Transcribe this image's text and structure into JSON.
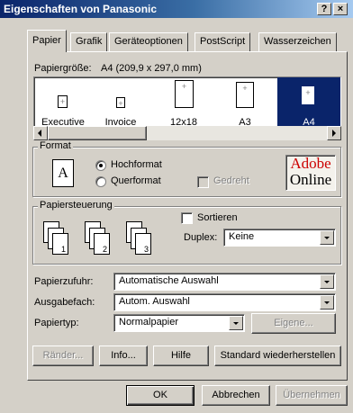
{
  "window": {
    "title": "Eigenschaften von Panasonic",
    "help_button": "?",
    "close_button": "×"
  },
  "tabs": [
    {
      "label": "Papier",
      "active": true
    },
    {
      "label": "Grafik",
      "active": false
    },
    {
      "label": "Geräteoptionen",
      "active": false
    },
    {
      "label": "PostScript",
      "active": false
    },
    {
      "label": "Wasserzeichen",
      "active": false
    }
  ],
  "paper_size": {
    "label": "Papiergröße:",
    "value": "A4 (209,9 x 297,0 mm)",
    "items": [
      {
        "name": "Executive",
        "selected": false
      },
      {
        "name": "Invoice",
        "selected": false
      },
      {
        "name": "12x18",
        "selected": false
      },
      {
        "name": "A3",
        "selected": false
      },
      {
        "name": "A4",
        "selected": true
      }
    ],
    "selection_color": "#0a246a"
  },
  "format": {
    "label": "Format",
    "options": [
      {
        "label": "Hochformat",
        "checked": true
      },
      {
        "label": "Querformat",
        "checked": false
      }
    ],
    "rotated_label": "Gedreht",
    "rotated_enabled": false,
    "preview_letter": "A",
    "adobe_line1": "Adobe",
    "adobe_line2": "Online",
    "adobe_color": "#cc0000"
  },
  "paper_control": {
    "label": "Papiersteuerung",
    "sort_label": "Sortieren",
    "duplex_label": "Duplex:",
    "duplex_value": "Keine",
    "copy_numbers": [
      "1",
      "2",
      "3"
    ]
  },
  "fields": [
    {
      "label": "Papierzufuhr:",
      "value": "Automatische Auswahl"
    },
    {
      "label": "Ausgabefach:",
      "value": "Autom. Auswahl"
    },
    {
      "label": "Papiertyp:",
      "value": "Normalpapier"
    }
  ],
  "buttons": {
    "own": "Eigene...",
    "margins": "Ränder...",
    "info": "Info...",
    "help": "Hilfe",
    "restore": "Standard wiederherstellen",
    "ok": "OK",
    "cancel": "Abbrechen",
    "apply": "Übernehmen"
  }
}
